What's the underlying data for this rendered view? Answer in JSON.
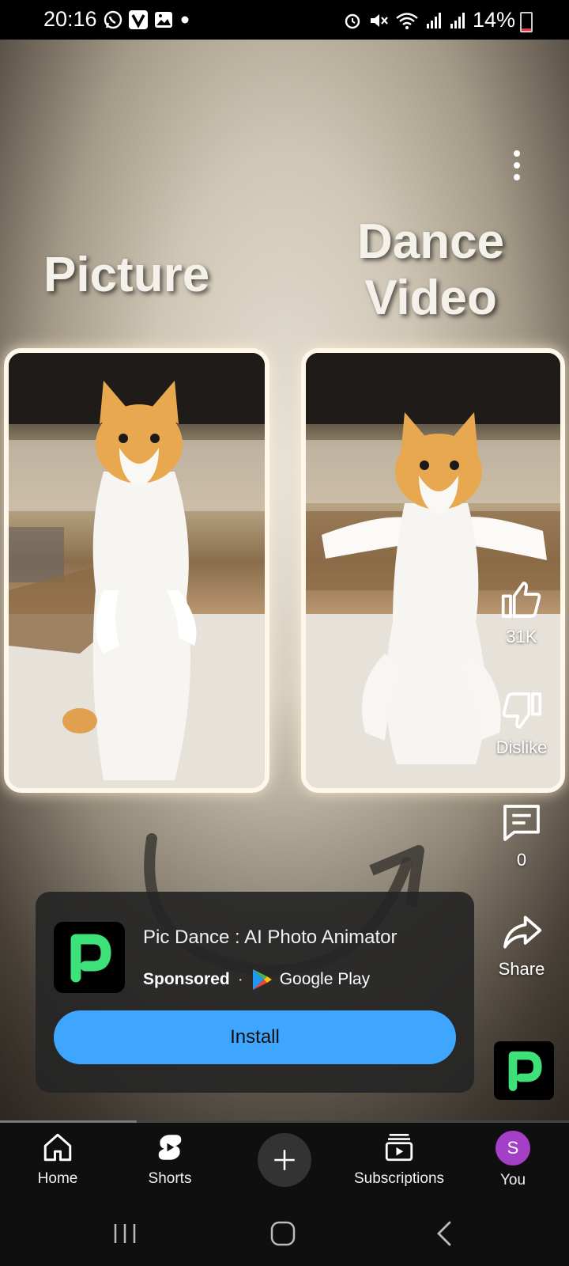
{
  "status_bar": {
    "time": "20:16",
    "battery": "14%",
    "battery_level": 0.14,
    "left_icons": [
      "whatsapp-icon",
      "v-app-icon",
      "gallery-icon",
      "dot-icon"
    ],
    "right_icons": [
      "alarm-icon",
      "mute-icon",
      "wifi-icon",
      "signal-icon",
      "signal-icon",
      "battery-icon"
    ]
  },
  "video": {
    "label_left": "Picture",
    "label_right_line1": "Dance",
    "label_right_line2": "Video",
    "more_icon": "more-vert-icon"
  },
  "actions": {
    "like_count": "31K",
    "dislike_label": "Dislike",
    "comment_count": "0",
    "share_label": "Share"
  },
  "ad": {
    "title": "Pic Dance : AI Photo Animator",
    "sponsored": "Sponsored",
    "separator": "·",
    "store": "Google Play",
    "install_label": "Install",
    "install_color": "#3ea6ff",
    "logo_color": "#3ee07a"
  },
  "progress": 0.24,
  "nav": {
    "home": "Home",
    "shorts": "Shorts",
    "subscriptions": "Subscriptions",
    "you": "You",
    "avatar_letter": "S",
    "avatar_color": "#a43fc7"
  }
}
